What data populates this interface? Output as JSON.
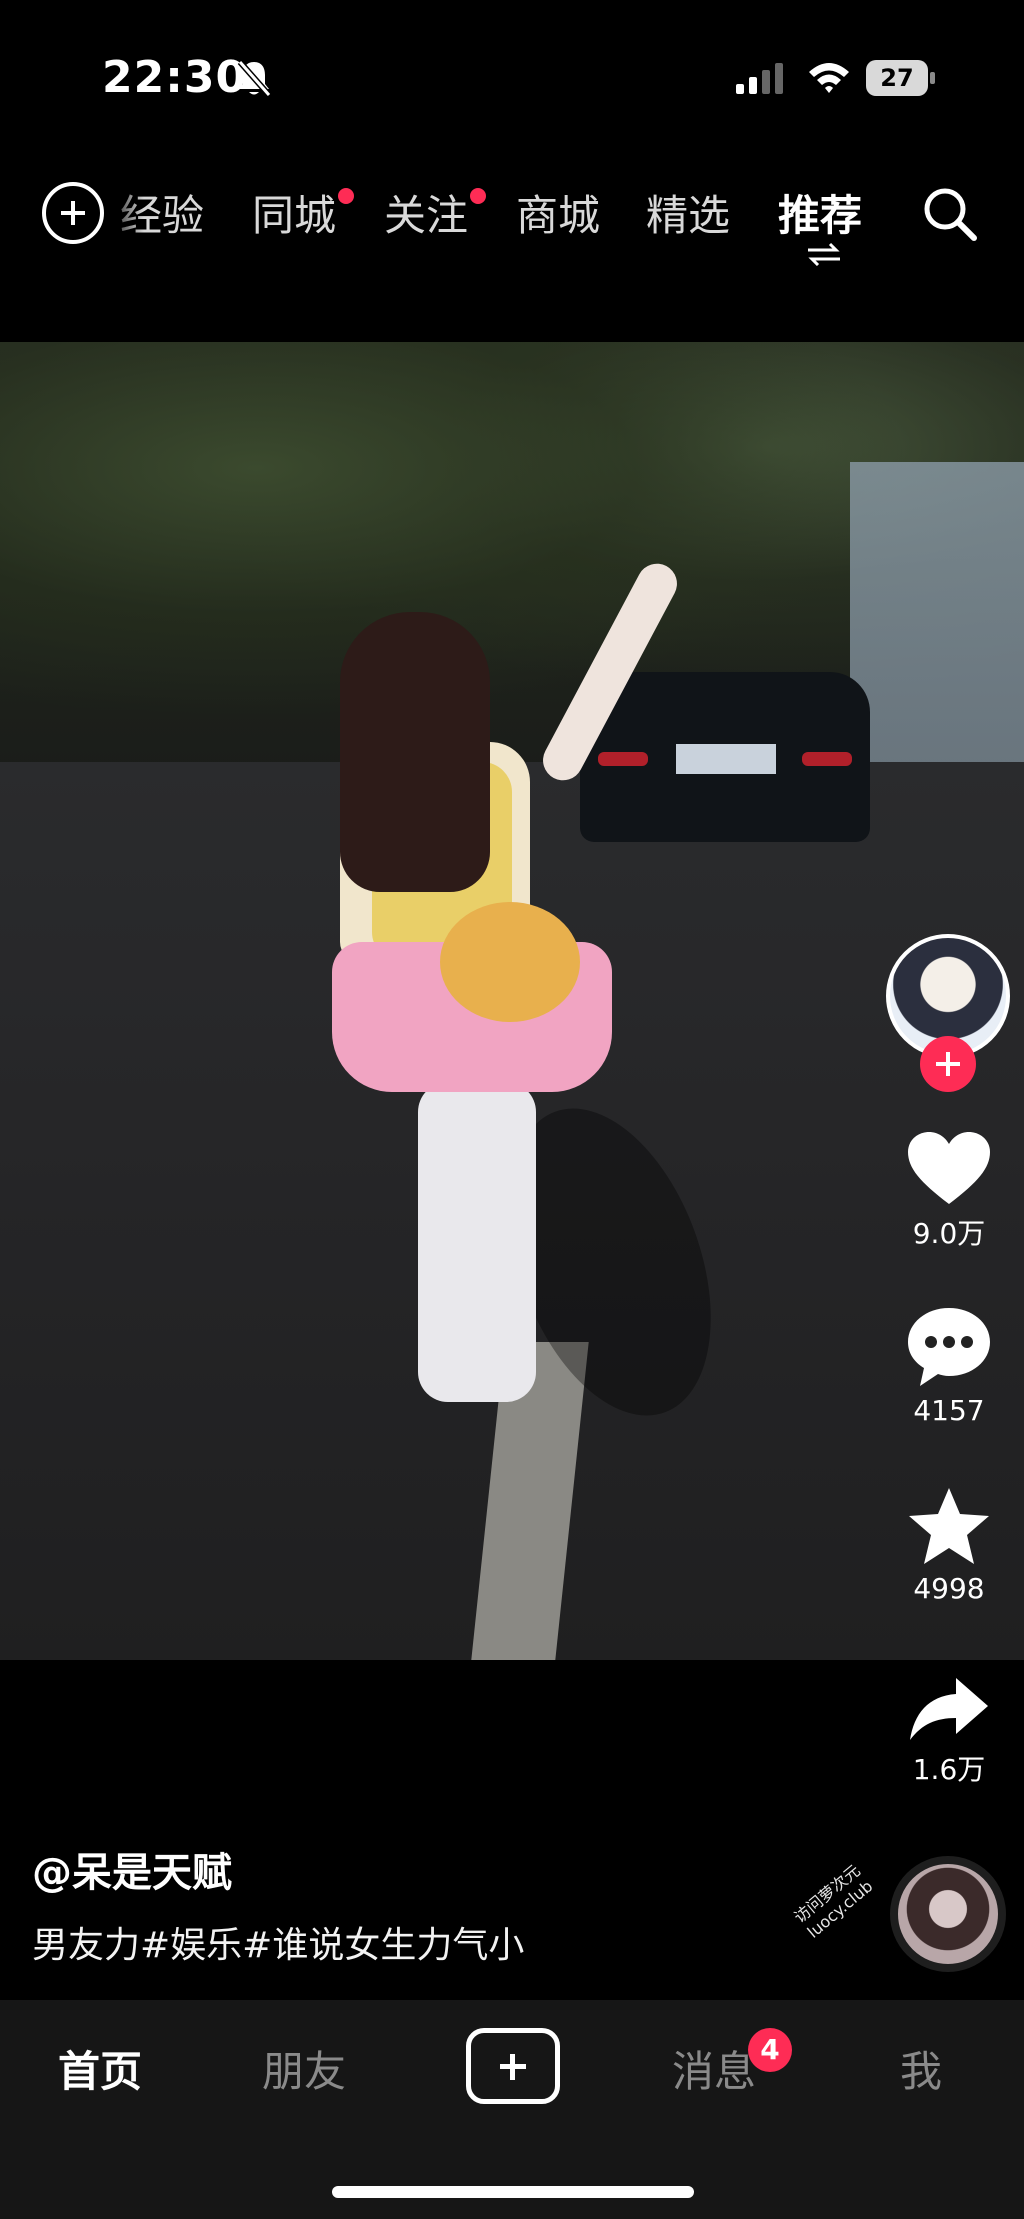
{
  "status_bar": {
    "time": "22:30",
    "battery": "27"
  },
  "top_nav": {
    "tabs": [
      {
        "label": "经验",
        "dot": false,
        "active": false
      },
      {
        "label": "同城",
        "dot": true,
        "active": false
      },
      {
        "label": "关注",
        "dot": true,
        "active": false
      },
      {
        "label": "商城",
        "dot": false,
        "active": false
      },
      {
        "label": "精选",
        "dot": false,
        "active": false
      },
      {
        "label": "推荐",
        "dot": false,
        "active": true
      }
    ]
  },
  "actions": {
    "likes": "9.0万",
    "comments": "4157",
    "favorites": "4998",
    "shares": "1.6万"
  },
  "caption": {
    "author": "@呆是天赋",
    "description": "男友力#娱乐#谁说女生力气小"
  },
  "watermark": {
    "line1": "访问萝次元",
    "line2": "luocy.club"
  },
  "bottom_bar": {
    "home": "首页",
    "friends": "朋友",
    "messages": "消息",
    "messages_badge": "4",
    "me": "我"
  },
  "colors": {
    "accent": "#fe2c55",
    "background": "#000000",
    "tab_bar": "#161616"
  },
  "icons": [
    "bell-muted-icon",
    "signal-icon",
    "wifi-icon",
    "battery-icon",
    "add-circle-icon",
    "swap-icon",
    "search-icon",
    "heart-icon",
    "comment-icon",
    "star-icon",
    "share-icon",
    "plus-icon"
  ]
}
